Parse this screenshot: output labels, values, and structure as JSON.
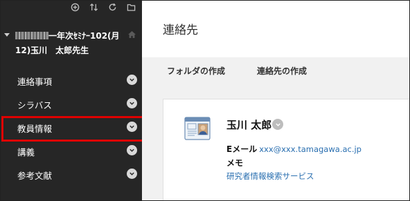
{
  "sidebar": {
    "toolbar": [
      {
        "icon": "add-circle-icon"
      },
      {
        "icon": "sort-arrows-icon"
      },
      {
        "icon": "refresh-icon"
      },
      {
        "icon": "folder-icon"
      }
    ],
    "course": {
      "title_line1_visible": "一年次ｾﾐﾅｰ102(月",
      "title_line2": "12)玉川　太郎先生"
    },
    "items": [
      {
        "label": "連絡事項"
      },
      {
        "label": "シラバス"
      },
      {
        "label": "教員情報",
        "highlighted": true
      },
      {
        "label": "講義"
      },
      {
        "label": "参考文献"
      }
    ]
  },
  "main": {
    "title": "連絡先",
    "actions": [
      "フォルダの作成",
      "連絡先の作成"
    ],
    "contact": {
      "name": "玉川 太郎",
      "email_label": "Eメール",
      "email": "xxx@xxx.tamagawa.ac.jp",
      "memo_label": "メモ",
      "link": "研究者情報検索サービス"
    }
  },
  "colors": {
    "sidebar_bg": "#262626",
    "highlight_border": "#e00000",
    "link": "#2a6fb0"
  }
}
